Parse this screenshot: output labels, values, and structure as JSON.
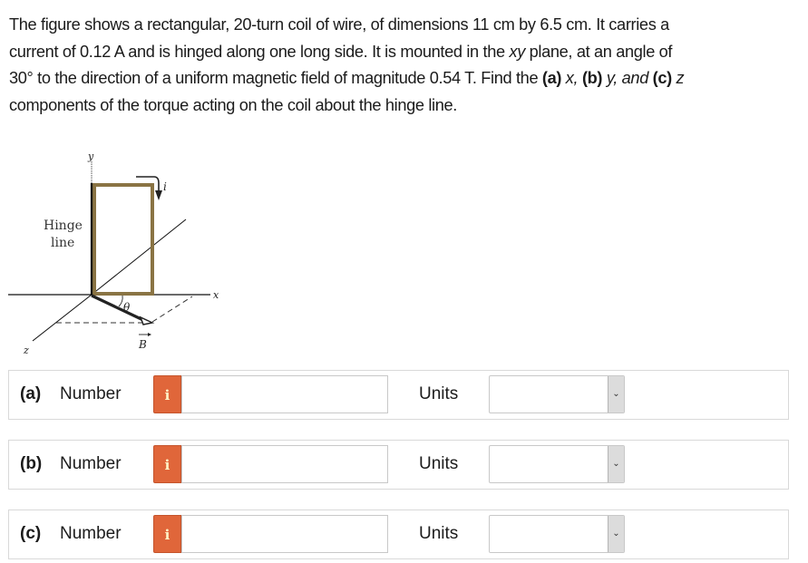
{
  "question": {
    "line1": "The figure shows a rectangular, 20-turn coil of wire, of dimensions 11 cm by 6.5 cm. It carries a",
    "line2_a": "current of 0.12 A and is hinged along one long side. It is mounted in the ",
    "line2_xy": "xy",
    "line2_b": " plane, at an angle of",
    "line3_a": "30° to the direction of a uniform magnetic field of magnitude 0.54 T. Find the ",
    "line3_pa": "(a)",
    "line3_x": " x, ",
    "line3_pb": "(b)",
    "line3_y": " y, and ",
    "line3_pc": "(c)",
    "line3_z": " z",
    "line4": "components of the torque acting on the coil about the hinge line."
  },
  "figure": {
    "label_y": "y",
    "label_x": "x",
    "label_z": "z",
    "label_i": "i",
    "label_theta": "θ",
    "label_B": "B",
    "hinge_line_1": "Hinge",
    "hinge_line_2": "line",
    "coil_color": "#8a7444"
  },
  "answers": [
    {
      "part": "(a)",
      "number_label": "Number",
      "info_icon": "i",
      "value": "",
      "units_label": "Units",
      "units_selected": ""
    },
    {
      "part": "(b)",
      "number_label": "Number",
      "info_icon": "i",
      "value": "",
      "units_label": "Units",
      "units_selected": ""
    },
    {
      "part": "(c)",
      "number_label": "Number",
      "info_icon": "i",
      "value": "",
      "units_label": "Units",
      "units_selected": ""
    }
  ],
  "colors": {
    "info_badge": "#e0663a",
    "border": "#d9d9d9"
  }
}
